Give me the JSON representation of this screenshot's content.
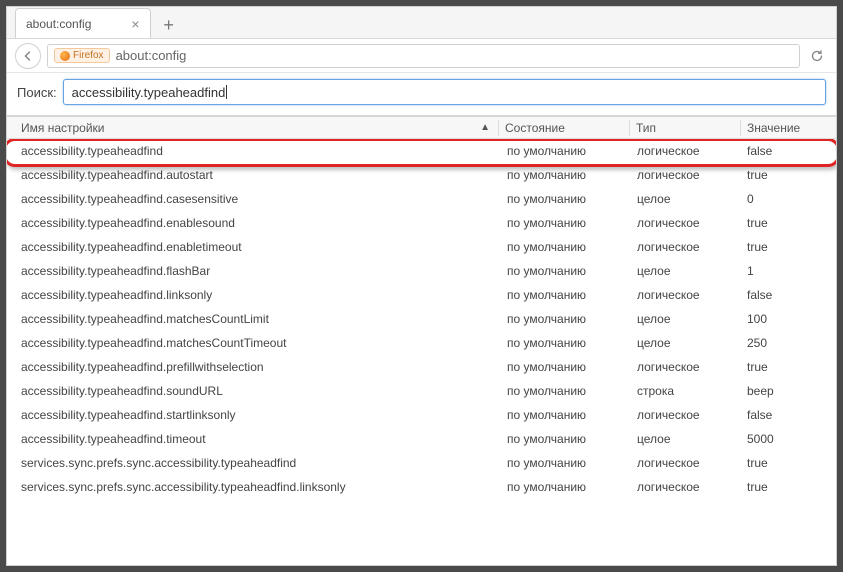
{
  "tab": {
    "title": "about:config"
  },
  "urlbar": {
    "identity": "Firefox",
    "url": "about:config"
  },
  "search": {
    "label": "Поиск:",
    "value": "accessibility.typeaheadfind"
  },
  "columns": {
    "name": "Имя настройки",
    "status": "Состояние",
    "type": "Тип",
    "value": "Значение",
    "sort_indicator": "▲"
  },
  "rows": [
    {
      "name": "accessibility.typeaheadfind",
      "status": "по умолчанию",
      "type": "логическое",
      "value": "false",
      "highlight": true
    },
    {
      "name": "accessibility.typeaheadfind.autostart",
      "status": "по умолчанию",
      "type": "логическое",
      "value": "true"
    },
    {
      "name": "accessibility.typeaheadfind.casesensitive",
      "status": "по умолчанию",
      "type": "целое",
      "value": "0"
    },
    {
      "name": "accessibility.typeaheadfind.enablesound",
      "status": "по умолчанию",
      "type": "логическое",
      "value": "true"
    },
    {
      "name": "accessibility.typeaheadfind.enabletimeout",
      "status": "по умолчанию",
      "type": "логическое",
      "value": "true"
    },
    {
      "name": "accessibility.typeaheadfind.flashBar",
      "status": "по умолчанию",
      "type": "целое",
      "value": "1"
    },
    {
      "name": "accessibility.typeaheadfind.linksonly",
      "status": "по умолчанию",
      "type": "логическое",
      "value": "false"
    },
    {
      "name": "accessibility.typeaheadfind.matchesCountLimit",
      "status": "по умолчанию",
      "type": "целое",
      "value": "100"
    },
    {
      "name": "accessibility.typeaheadfind.matchesCountTimeout",
      "status": "по умолчанию",
      "type": "целое",
      "value": "250"
    },
    {
      "name": "accessibility.typeaheadfind.prefillwithselection",
      "status": "по умолчанию",
      "type": "логическое",
      "value": "true"
    },
    {
      "name": "accessibility.typeaheadfind.soundURL",
      "status": "по умолчанию",
      "type": "строка",
      "value": "beep"
    },
    {
      "name": "accessibility.typeaheadfind.startlinksonly",
      "status": "по умолчанию",
      "type": "логическое",
      "value": "false"
    },
    {
      "name": "accessibility.typeaheadfind.timeout",
      "status": "по умолчанию",
      "type": "целое",
      "value": "5000"
    },
    {
      "name": "services.sync.prefs.sync.accessibility.typeaheadfind",
      "status": "по умолчанию",
      "type": "логическое",
      "value": "true"
    },
    {
      "name": "services.sync.prefs.sync.accessibility.typeaheadfind.linksonly",
      "status": "по умолчанию",
      "type": "логическое",
      "value": "true"
    }
  ]
}
